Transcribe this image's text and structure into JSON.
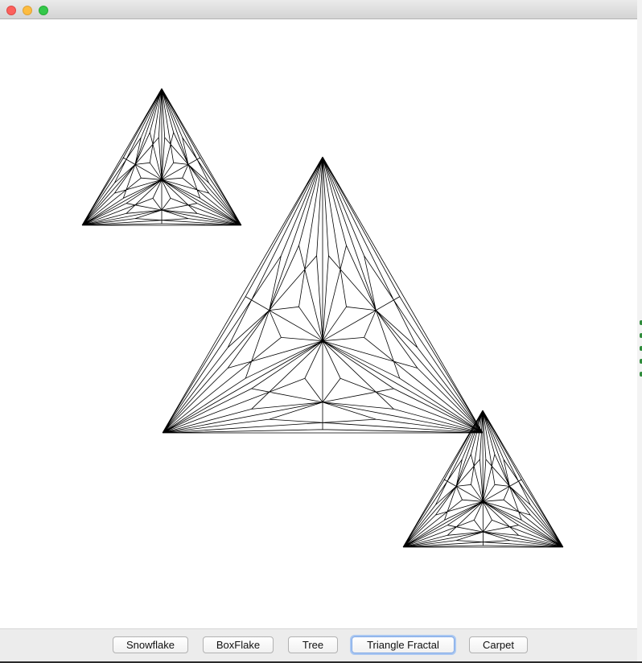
{
  "window": {
    "title": ""
  },
  "buttons": [
    {
      "id": "snowflake",
      "label": "Snowflake"
    },
    {
      "id": "boxflake",
      "label": "BoxFlake"
    },
    {
      "id": "tree",
      "label": "Tree"
    },
    {
      "id": "triangle-fractal",
      "label": "Triangle Fractal"
    },
    {
      "id": "carpet",
      "label": "Carpet"
    }
  ],
  "selected_button": "Triangle Fractal",
  "canvas": {
    "background": "#ffffff",
    "stroke_color": "#000000",
    "fractal_type": "triangle fractal",
    "triangle_count": 3
  },
  "colors": {
    "close": "#fc605c",
    "minimize": "#fdbc40",
    "maximize": "#34c84a",
    "focus_ring": "#a9c7f2"
  }
}
